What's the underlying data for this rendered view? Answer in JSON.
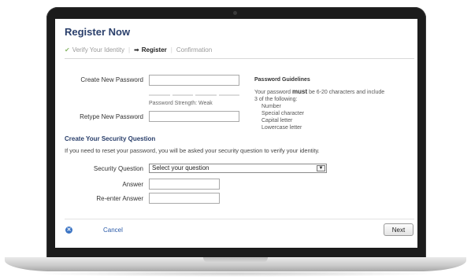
{
  "page": {
    "title": "Register Now"
  },
  "steps": {
    "step1": "Verify Your Identity",
    "step2": "Register",
    "step3": "Confirmation"
  },
  "password": {
    "new_label": "Create New Password",
    "new_value": "",
    "strength_text": "Password Strength: Weak",
    "retype_label": "Retype New Password",
    "retype_value": ""
  },
  "guidelines": {
    "title": "Password Guidelines",
    "text_pre": "Your password ",
    "text_must": "must",
    "text_post": " be 6-20 characters and include 3 of the following:",
    "items": [
      "Number",
      "Special character",
      "Capital letter",
      "Lowercase letter"
    ]
  },
  "security": {
    "section_title": "Create Your Security Question",
    "description": "If you need to reset your password, you will be asked your security question to verify your identity.",
    "question_label": "Security Question",
    "question_selected": "Select your question",
    "answer_label": "Answer",
    "answer_value": "",
    "reenter_label": "Re-enter Answer",
    "reenter_value": ""
  },
  "footer": {
    "cancel_label": "Cancel",
    "next_label": "Next"
  },
  "colors": {
    "heading": "#2a3f6b",
    "link": "#2a5aa8",
    "check": "#8bb86a"
  },
  "icons": {
    "completed_step": "check-icon",
    "current_step": "arrow-right-icon",
    "dropdown": "chevron-down-icon",
    "cancel": "close-circle-icon"
  }
}
